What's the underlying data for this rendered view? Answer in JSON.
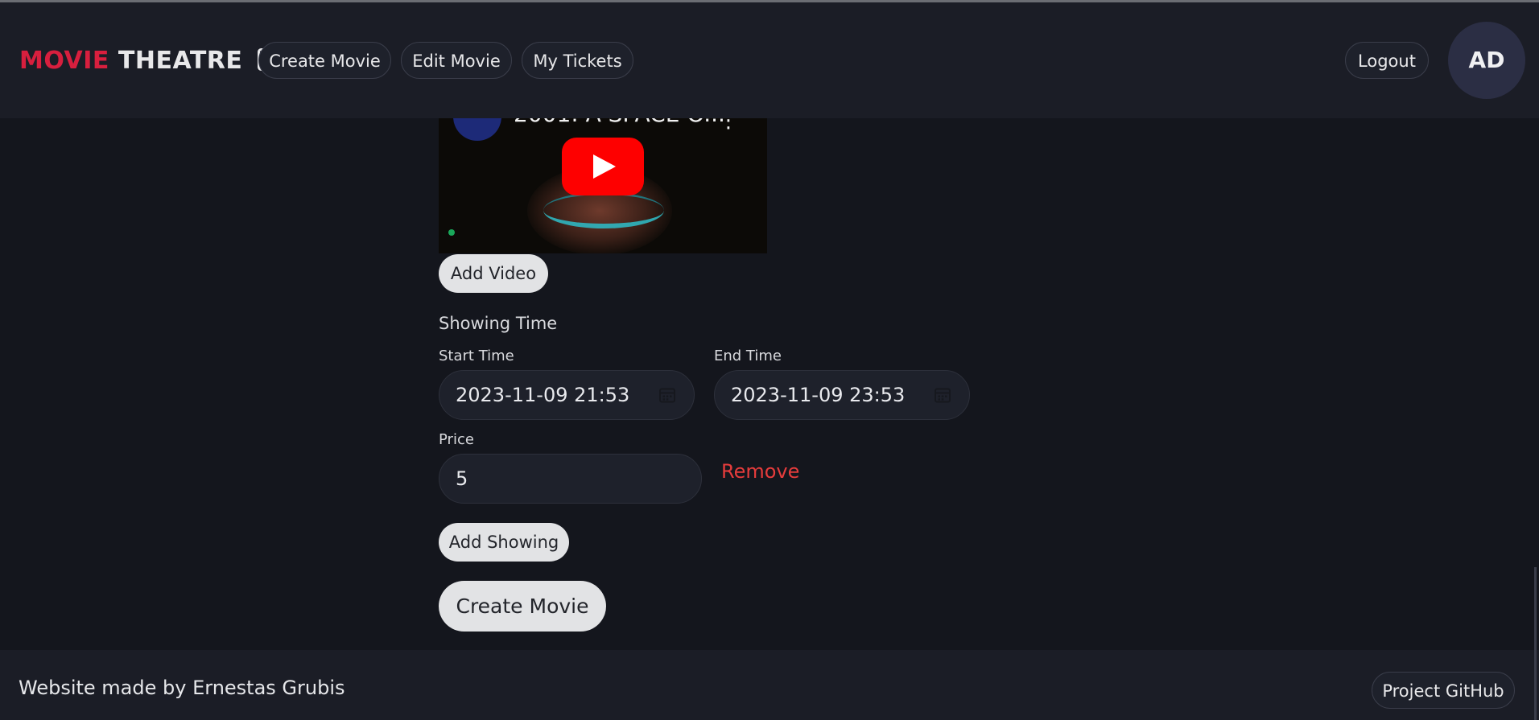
{
  "header": {
    "brand_word1": "MOVIE",
    "brand_word2": "THEATRE",
    "brand_icon": "film-icon",
    "nav": [
      {
        "label": "Create Movie"
      },
      {
        "label": "Edit Movie"
      },
      {
        "label": "My Tickets"
      }
    ],
    "logout_label": "Logout",
    "avatar_initials": "AD"
  },
  "video": {
    "title": "2001: A SPACE O...",
    "channel_icon": "channel-avatar-icon",
    "play_icon": "youtube-play-icon",
    "menu_icon": "more-vert-icon"
  },
  "form": {
    "add_video_label": "Add Video",
    "showing_heading": "Showing Time",
    "start_label": "Start Time",
    "start_value": "2023-11-09 21:53",
    "end_label": "End Time",
    "end_value": "2023-11-09 23:53",
    "price_label": "Price",
    "price_value": "5",
    "remove_label": "Remove",
    "add_showing_label": "Add Showing",
    "submit_label": "Create Movie"
  },
  "footer": {
    "credit": "Website made by Ernestas Grubis",
    "github_label": "Project GitHub"
  },
  "colors": {
    "background": "#14161d",
    "header_bg": "#1b1d26",
    "brand_red": "#d81f3e",
    "remove_red": "#e63c3c",
    "youtube_red": "#fe0000"
  }
}
